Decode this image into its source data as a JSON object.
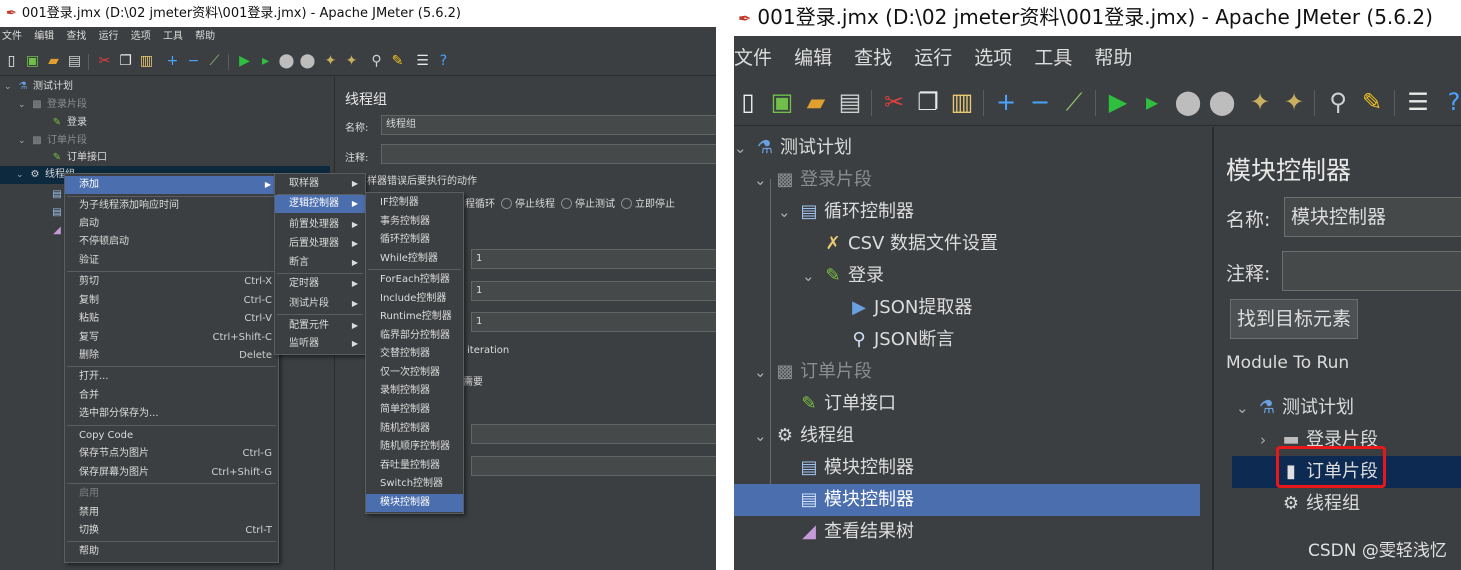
{
  "left": {
    "title": "001登录.jmx (D:\\02 jmeter资料\\001登录.jmx) - Apache JMeter (5.6.2)",
    "menu": [
      "文件",
      "编辑",
      "查找",
      "运行",
      "选项",
      "工具",
      "帮助"
    ],
    "tree": {
      "test_plan": "测试计划",
      "login_fragment": "登录片段",
      "login": "登录",
      "order_fragment": "订单片段",
      "order_api": "订单接口",
      "thread_group": "线程组"
    },
    "panel": {
      "title": "线程组",
      "name_label": "名称:",
      "name_value": "线程组",
      "comment_label": "注释:",
      "sampler_error": "样器错误后要执行的动作",
      "radio_options": [
        "进程循环",
        "停止线程",
        "停止测试",
        "立即停止"
      ],
      "field_values": [
        "1",
        "1",
        "1"
      ],
      "iteration": "iteration",
      "need": "需要"
    },
    "context_menu": [
      {
        "label": "添加",
        "submenu": true,
        "selected": true
      },
      {
        "label": "为子线程添加响应时间"
      },
      {
        "label": "启动"
      },
      {
        "label": "不停顿启动"
      },
      {
        "label": "验证"
      },
      {
        "label": "剪切",
        "shortcut": "Ctrl-X"
      },
      {
        "label": "复制",
        "shortcut": "Ctrl-C"
      },
      {
        "label": "粘贴",
        "shortcut": "Ctrl-V"
      },
      {
        "label": "复写",
        "shortcut": "Ctrl+Shift-C"
      },
      {
        "label": "删除",
        "shortcut": "Delete"
      },
      {
        "label": "打开..."
      },
      {
        "label": "合并"
      },
      {
        "label": "选中部分保存为..."
      },
      {
        "label": "Copy Code"
      },
      {
        "label": "保存节点为图片",
        "shortcut": "Ctrl-G"
      },
      {
        "label": "保存屏幕为图片",
        "shortcut": "Ctrl+Shift-G"
      },
      {
        "label": "启用",
        "disabled": true
      },
      {
        "label": "禁用"
      },
      {
        "label": "切换",
        "shortcut": "Ctrl-T"
      },
      {
        "label": "帮助"
      }
    ],
    "add_menu": [
      "取样器",
      "逻辑控制器",
      "前置处理器",
      "后置处理器",
      "断言",
      "定时器",
      "测试片段",
      "配置元件",
      "监听器"
    ],
    "logic_menu": [
      "IF控制器",
      "事务控制器",
      "循环控制器",
      "While控制器",
      "ForEach控制器",
      "Include控制器",
      "Runtime控制器",
      "临界部分控制器",
      "交替控制器",
      "仅一次控制器",
      "录制控制器",
      "简单控制器",
      "随机控制器",
      "随机顺序控制器",
      "吞吐量控制器",
      "Switch控制器",
      "模块控制器"
    ]
  },
  "right": {
    "title": "001登录.jmx (D:\\02 jmeter资料\\001登录.jmx) - Apache JMeter (5.6.2)",
    "menu": [
      "文件",
      "编辑",
      "查找",
      "运行",
      "选项",
      "工具",
      "帮助"
    ],
    "tree": {
      "test_plan": "测试计划",
      "login_fragment": "登录片段",
      "loop_controller": "循环控制器",
      "csv": "CSV 数据文件设置",
      "login": "登录",
      "json_extractor": "JSON提取器",
      "json_assert": "JSON断言",
      "order_fragment": "订单片段",
      "order_api": "订单接口",
      "thread_group": "线程组",
      "module_controller_1": "模块控制器",
      "module_controller_2": "模块控制器",
      "result_tree": "查看结果树"
    },
    "panel": {
      "title": "模块控制器",
      "name_label": "名称:",
      "name_value": "模块控制器",
      "comment_label": "注释:",
      "find_button": "找到目标元素",
      "module_to_run": "Module To Run",
      "mt_test_plan": "测试计划",
      "mt_login_fragment": "登录片段",
      "mt_order_fragment": "订单片段",
      "mt_thread_group": "线程组"
    },
    "watermark": "CSDN @雯轻浅忆"
  }
}
